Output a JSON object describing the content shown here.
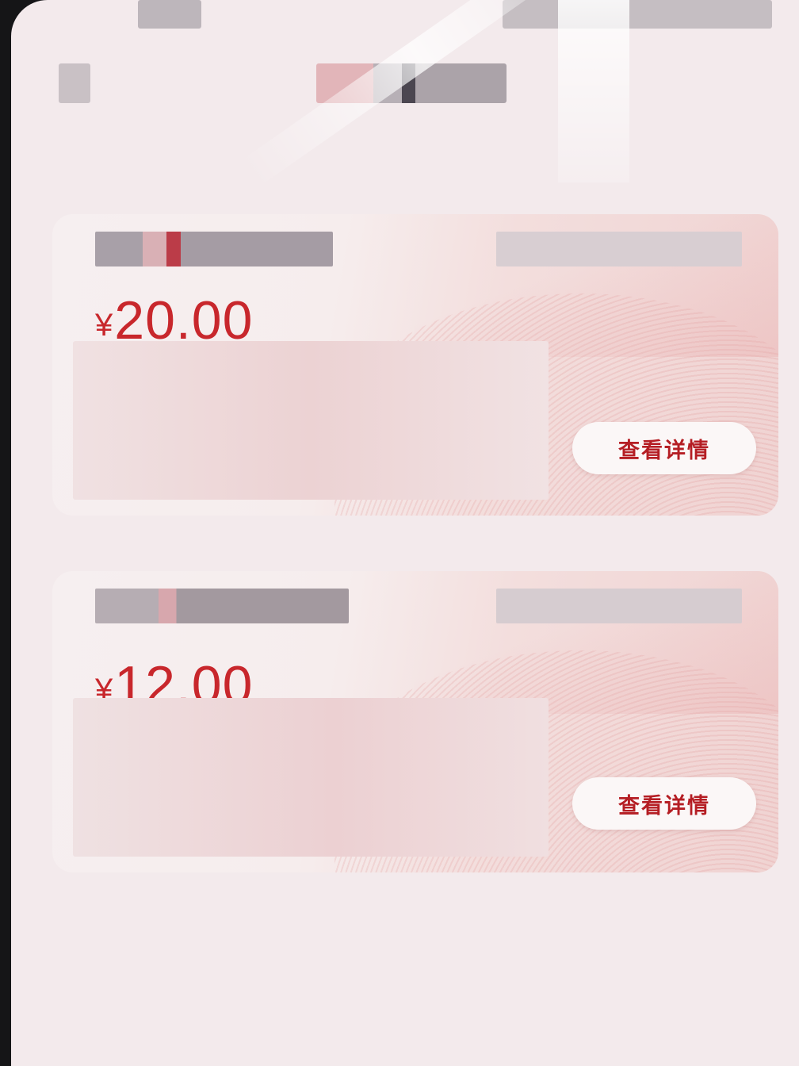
{
  "coupons": [
    {
      "currency_symbol": "¥",
      "amount": "20.00",
      "action_label": "查看详情"
    },
    {
      "currency_symbol": "¥",
      "amount": "12.00",
      "action_label": "查看详情"
    }
  ],
  "colors": {
    "accent_red": "#c8272c",
    "button_text": "#b51e24",
    "screen_background": "#f3eaec",
    "card_pink": "#f0d3d2"
  }
}
